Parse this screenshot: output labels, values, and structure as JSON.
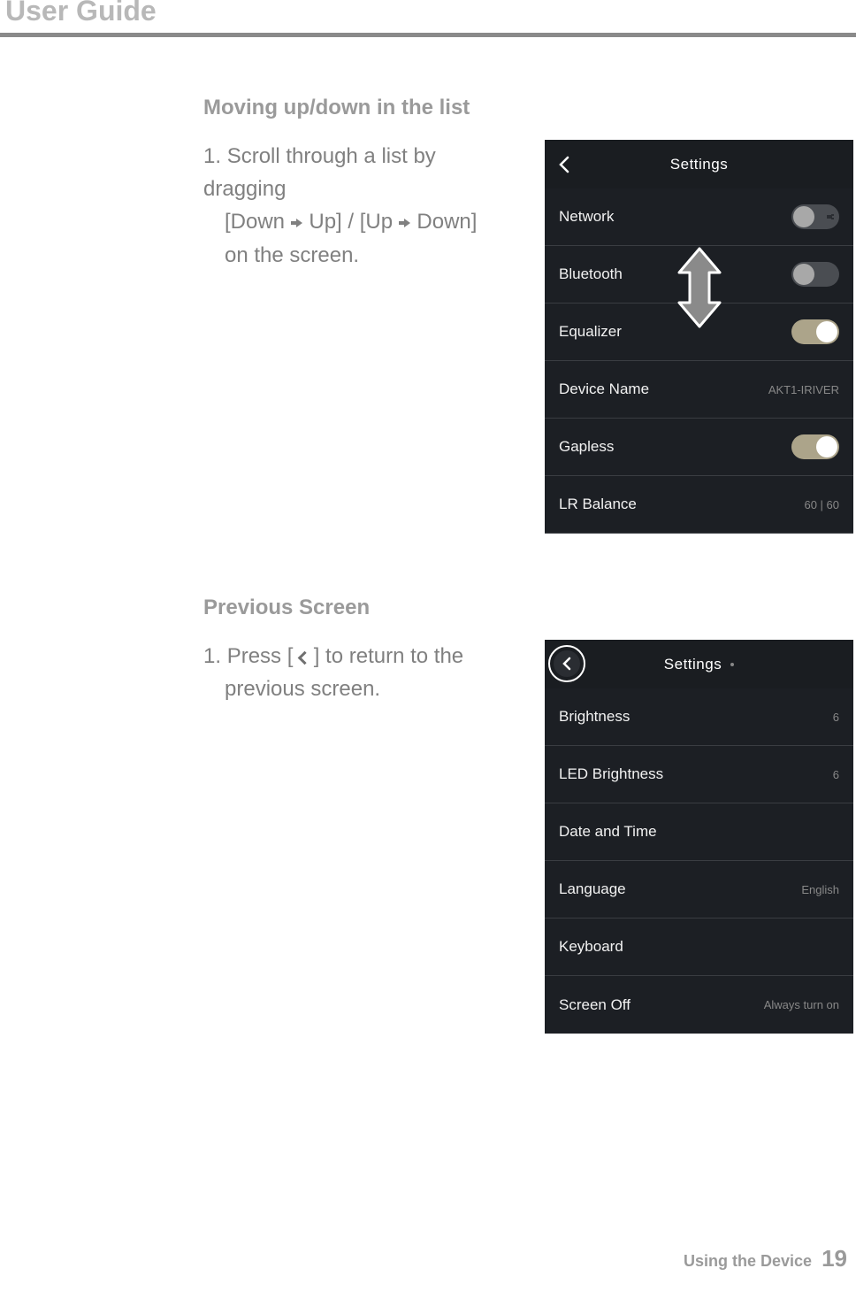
{
  "doc_title": "User Guide",
  "section1": {
    "heading": "Moving up/down in the list",
    "step_num": "1.",
    "line1_a": "Scroll through a list by dragging",
    "line2_a": "[Down ",
    "line2_b": " Up] / [Up ",
    "line2_c": " Down]",
    "line3": "on the screen."
  },
  "section2": {
    "heading": "Previous Screen",
    "step_num": "1.",
    "line1_a": "Press [ ",
    "line1_b": " ] to return to the",
    "line2": "previous screen."
  },
  "phone1": {
    "title": "Settings",
    "rows": {
      "network": {
        "label": "Network"
      },
      "bluetooth": {
        "label": "Bluetooth"
      },
      "equalizer": {
        "label": "Equalizer"
      },
      "device_name": {
        "label": "Device Name",
        "value": "AKT1-IRIVER"
      },
      "gapless": {
        "label": "Gapless"
      },
      "lr_balance": {
        "label": "LR Balance",
        "value": "60 | 60"
      }
    }
  },
  "phone2": {
    "title": "Settings",
    "rows": {
      "brightness": {
        "label": "Brightness",
        "value": "6"
      },
      "led_brightness": {
        "label": "LED Brightness",
        "value": "6"
      },
      "date_time": {
        "label": "Date and Time"
      },
      "language": {
        "label": "Language",
        "value": "English"
      },
      "keyboard": {
        "label": "Keyboard"
      },
      "screen_off": {
        "label": "Screen Off",
        "value": "Always turn on"
      }
    }
  },
  "footer": {
    "chapter": "Using the Device",
    "page": "19"
  }
}
